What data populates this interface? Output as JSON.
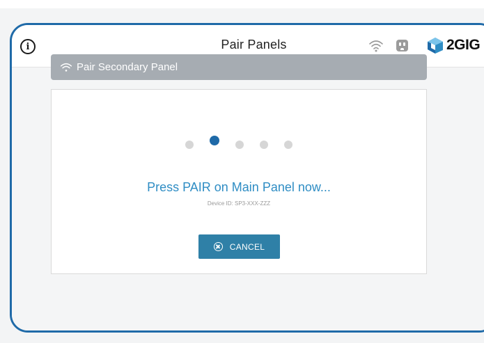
{
  "header": {
    "info_label": "i",
    "title": "Pair Panels",
    "logo_text": "2GIG",
    "icons": [
      "info-icon",
      "wifi-icon",
      "outlet-icon",
      "2gig-logo-icon"
    ]
  },
  "section": {
    "title": "Pair Secondary Panel",
    "icon": "wifi-icon"
  },
  "progress": {
    "total_steps": 5,
    "active_step": 2
  },
  "message": {
    "prompt": "Press PAIR on Main Panel now...",
    "device_id": "Device ID: SP3-XXX-ZZZ"
  },
  "actions": {
    "cancel_label": "CANCEL",
    "cancel_icon": "cancel-circle-icon"
  },
  "colors": {
    "accent": "#1f6aa8",
    "prompt_text": "#2f8dc4",
    "button": "#2f80a7",
    "section_bar": "#a6acb2"
  }
}
